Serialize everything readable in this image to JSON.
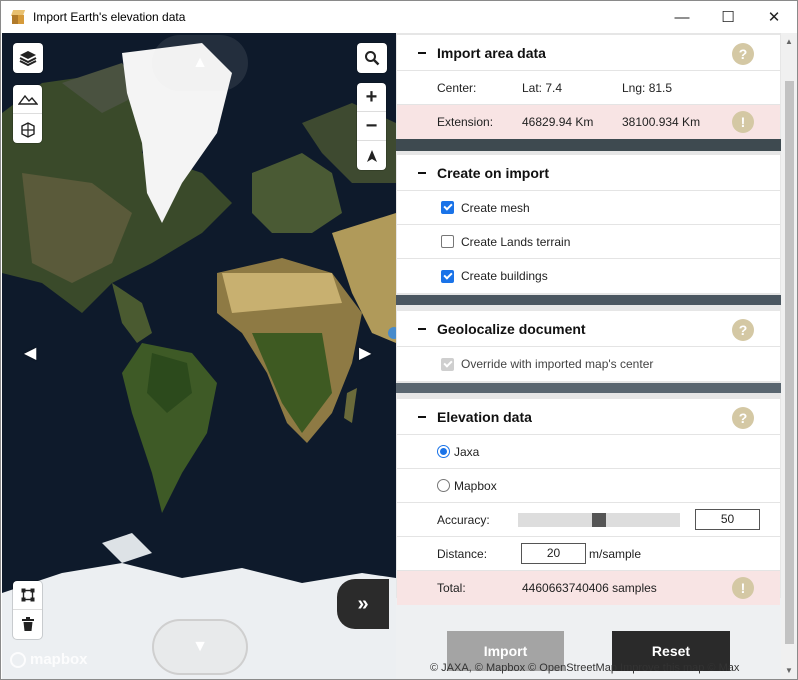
{
  "window": {
    "title": "Import Earth's elevation data",
    "minimize_glyph": "—",
    "maximize_glyph": "☐",
    "close_glyph": "✕"
  },
  "map": {
    "logo_text": "mapbox",
    "zoom_in": "+",
    "zoom_out": "−",
    "expand_glyph": "»",
    "arrow_up": "▲",
    "arrow_down": "▼",
    "arrow_left": "◀",
    "arrow_right": "▶"
  },
  "import_area": {
    "title": "Import area data",
    "center_label": "Center:",
    "lat": "Lat: 7.4",
    "lng": "Lng: 81.5",
    "extension_label": "Extension:",
    "extension_x": "46829.94 Km",
    "extension_y": "38100.934 Km"
  },
  "create_on_import": {
    "title": "Create on import",
    "options": [
      {
        "label": "Create mesh",
        "checked": true
      },
      {
        "label": "Create Lands terrain",
        "checked": false
      },
      {
        "label": "Create buildings",
        "checked": true
      }
    ]
  },
  "geolocalize": {
    "title": "Geolocalize document",
    "option_label": "Override with imported map's center",
    "checked": true,
    "disabled": true
  },
  "elevation": {
    "title": "Elevation data",
    "sources": [
      {
        "label": "Jaxa",
        "selected": true
      },
      {
        "label": "Mapbox",
        "selected": false
      }
    ],
    "accuracy_label": "Accuracy:",
    "accuracy_value": "50",
    "distance_label": "Distance:",
    "distance_value": "20",
    "distance_unit": "m/sample",
    "total_label": "Total:",
    "total_value": "4460663740406 samples"
  },
  "help_glyph": "?",
  "warn_glyph": "!",
  "buttons": {
    "import": "Import",
    "reset": "Reset"
  },
  "attribution": "© JAXA, © Mapbox © OpenStreetMap  Improve this map © Max",
  "colors": {
    "accent": "#1a73e8",
    "help": "#d4c8a4",
    "warn_row": "#f8e4e4",
    "reset_button": "#2a2a2a",
    "import_button": "#a4a4a4"
  }
}
